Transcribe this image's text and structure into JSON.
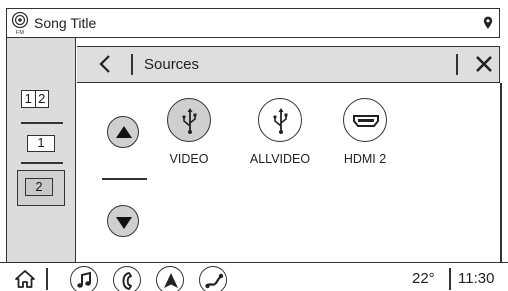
{
  "status": {
    "song_title": "Song Title",
    "radio_badge": "FM",
    "icons": {
      "radio": "radio-antenna-icon",
      "location": "location-pin-icon"
    }
  },
  "rail": {
    "buttons": [
      {
        "id": "split",
        "parts": [
          "1",
          "2"
        ]
      },
      {
        "id": "one",
        "label": "1"
      },
      {
        "id": "two",
        "label": "2",
        "selected": true
      }
    ]
  },
  "header": {
    "title": "Sources",
    "icons": {
      "back": "chevron-left-icon",
      "close": "close-icon"
    }
  },
  "sources": [
    {
      "label": "VIDEO",
      "icon": "usb-icon",
      "active": true
    },
    {
      "label": "ALLVIDEO",
      "icon": "usb-icon",
      "active": false
    },
    {
      "label": "HDMI 2",
      "icon": "hdmi-icon",
      "active": false
    }
  ],
  "scroll": {
    "up": "arrow-up-icon",
    "down": "arrow-down-icon"
  },
  "bottom": {
    "icons": [
      "home-icon",
      "music-icon",
      "phone-icon",
      "navigation-icon",
      "connect-icon"
    ],
    "temperature": "22°",
    "time": "11:30"
  },
  "colors": {
    "background": "#ffffff",
    "panel": "#dcdcdc",
    "outline": "#333333",
    "active_fill": "#cfcfcf"
  }
}
